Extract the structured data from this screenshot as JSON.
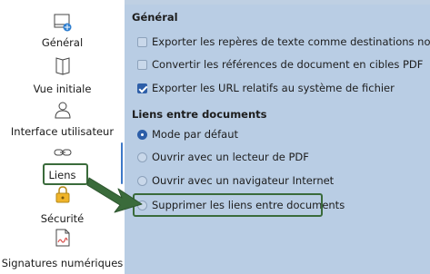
{
  "sidebar": {
    "items": [
      {
        "label": "Général",
        "icon": "document-settings-icon"
      },
      {
        "label": "Vue initiale",
        "icon": "open-book-icon"
      },
      {
        "label": "Interface utilisateur",
        "icon": "user-icon"
      },
      {
        "label": "Liens",
        "icon": "link-icon"
      },
      {
        "label": "Sécurité",
        "icon": "lock-icon"
      },
      {
        "label": "Signatures numériques",
        "icon": "signature-icon"
      }
    ]
  },
  "general": {
    "title": "Général",
    "options": [
      {
        "label": "Exporter les repères de texte comme destinations nommées",
        "checked": false
      },
      {
        "label": "Convertir les références de document en cibles PDF",
        "checked": false
      },
      {
        "label": "Exporter les URL relatifs au système de fichier",
        "checked": true
      }
    ]
  },
  "links": {
    "title": "Liens entre documents",
    "options": [
      {
        "label": "Mode par défaut",
        "selected": true
      },
      {
        "label": "Ouvrir avec un lecteur de PDF",
        "selected": false
      },
      {
        "label": "Ouvrir avec un navigateur Internet",
        "selected": false
      },
      {
        "label": "Supprimer les liens entre documents",
        "selected": false
      }
    ]
  },
  "colors": {
    "panel_bg": "#b9cde4",
    "highlight": "#3a6b3b",
    "arrow": "#3a6b3b",
    "accent": "#2d5ea8"
  }
}
